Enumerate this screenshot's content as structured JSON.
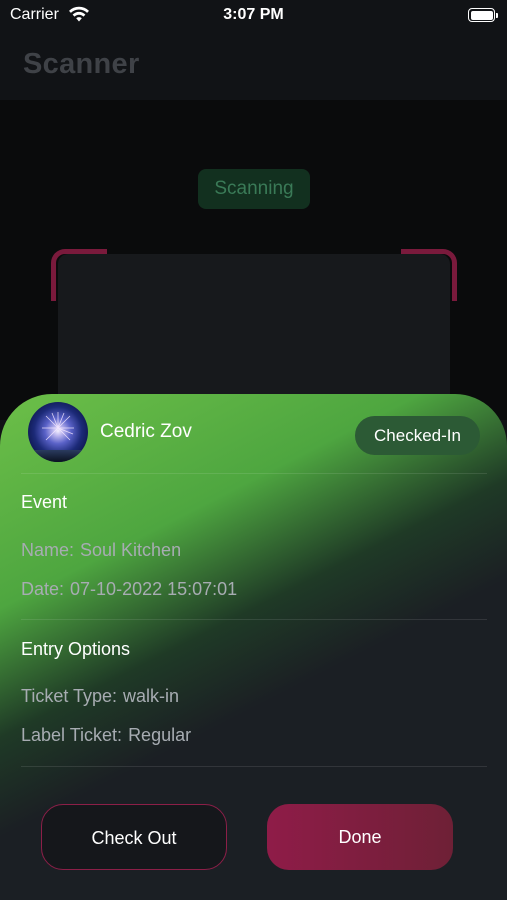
{
  "status_bar": {
    "carrier": "Carrier",
    "time": "3:07 PM"
  },
  "page_title": "Scanner",
  "scanner": {
    "status_label": "Scanning"
  },
  "attendee": {
    "name": "Cedric Zov",
    "status": "Checked-In"
  },
  "event_section": {
    "title": "Event",
    "name_label": "Name:",
    "name_value": "Soul Kitchen",
    "date_label": "Date:",
    "date_value": "07-10-2022 15:07:01"
  },
  "entry_section": {
    "title": "Entry Options",
    "ticket_type_label": "Ticket Type:",
    "ticket_type_value": "walk-in",
    "label_ticket_label": "Label Ticket:",
    "label_ticket_value": "Regular"
  },
  "actions": {
    "check_out_label": "Check Out",
    "done_label": "Done"
  },
  "colors": {
    "accent": "#8f1c48",
    "success": "#4ea640",
    "background": "#111316"
  }
}
